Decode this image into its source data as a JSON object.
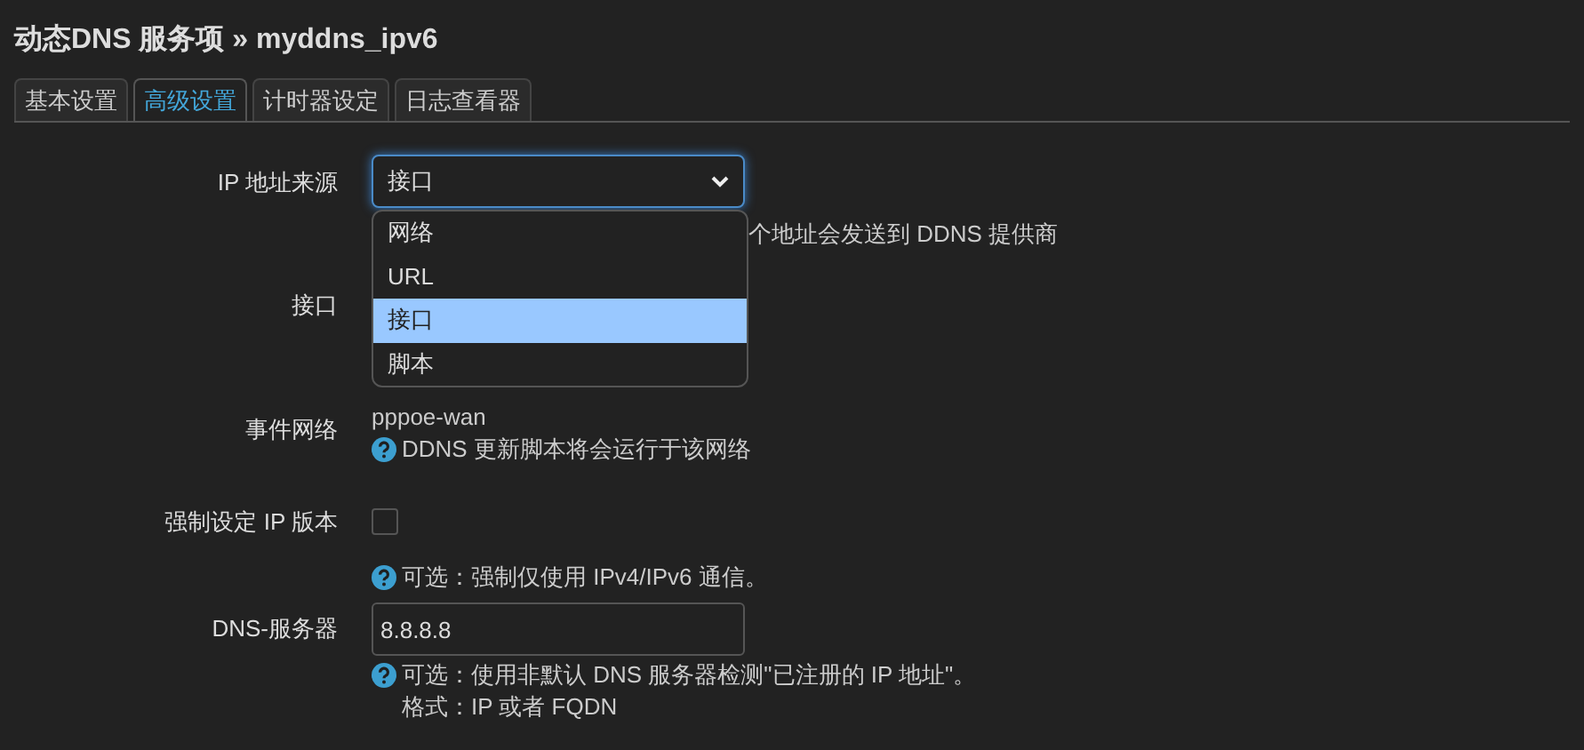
{
  "title": "动态DNS 服务项 » myddns_ipv6",
  "tabs": [
    {
      "label": "基本设置",
      "selected": false
    },
    {
      "label": "高级设置",
      "selected": true
    },
    {
      "label": "计时器设定",
      "selected": false
    },
    {
      "label": "日志查看器",
      "selected": false
    }
  ],
  "fields": [
    {
      "kind": "select",
      "label": "IP 地址来源",
      "value": "接口",
      "description": "个地址会发送到 DDNS 提供商",
      "expanded": true,
      "options": [
        {
          "label": "网络",
          "selected": false
        },
        {
          "label": "URL",
          "selected": false
        },
        {
          "label": "接口",
          "selected": true
        },
        {
          "label": "脚本",
          "selected": false
        }
      ]
    },
    {
      "kind": "hidden",
      "label": "接口"
    },
    {
      "kind": "static",
      "label": "事件网络",
      "value": "pppoe-wan",
      "help": [
        "DDNS 更新脚本将会运行于该网络"
      ]
    },
    {
      "kind": "checkbox",
      "label": "强制设定 IP 版本",
      "checked": false,
      "help": [
        "可选：强制仅使用 IPv4/IPv6 通信。"
      ]
    },
    {
      "kind": "text",
      "label": "DNS-服务器",
      "value": "8.8.8.8",
      "help": [
        "可选：使用非默认 DNS 服务器检测\"已注册的 IP 地址\"。",
        "格式：IP 或者 FQDN"
      ]
    }
  ]
}
